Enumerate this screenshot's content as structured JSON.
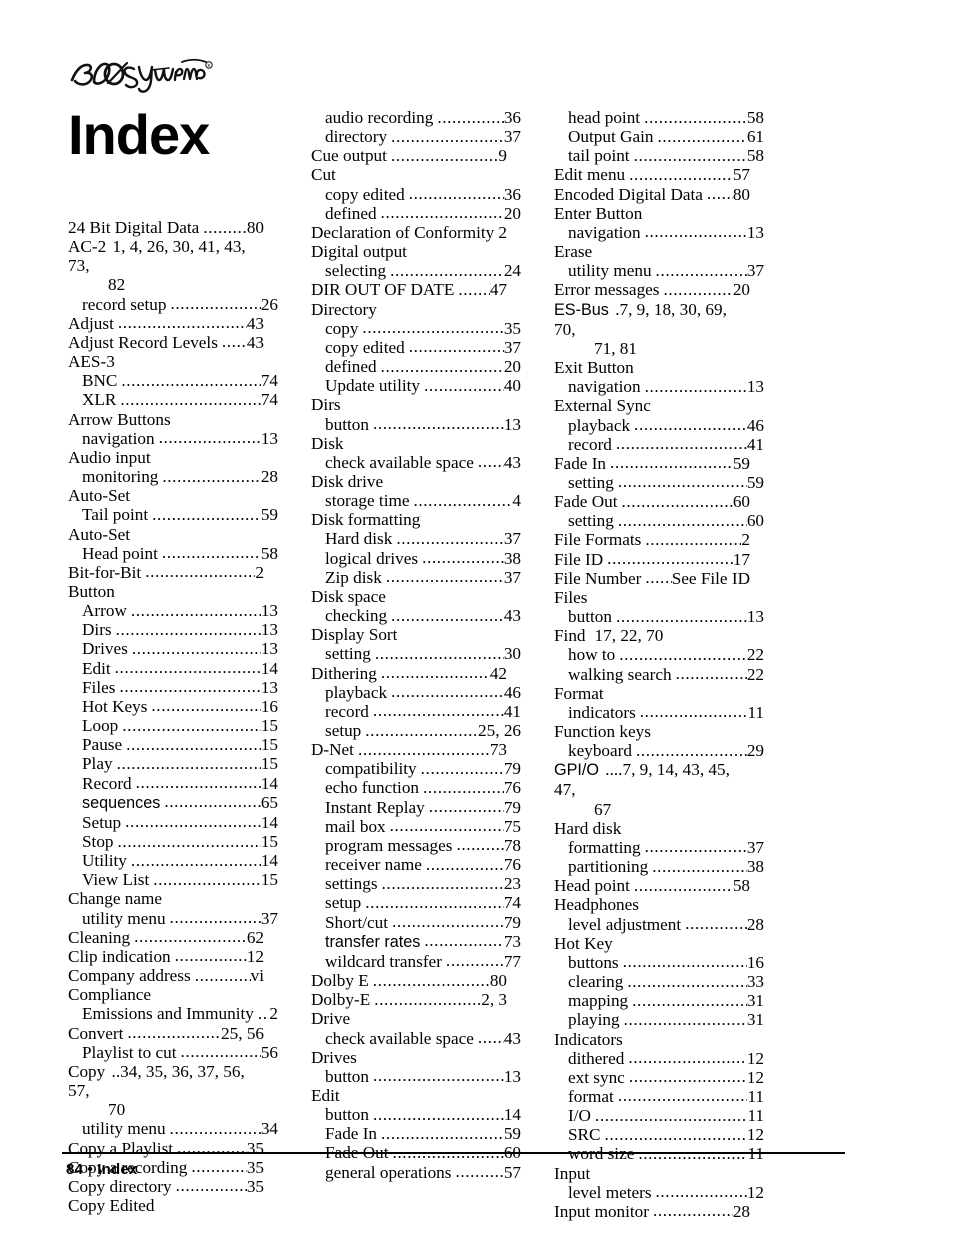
{
  "logo": {
    "alt_text": "360 Systems",
    "trademark": "®"
  },
  "page_title": "Index",
  "footer": {
    "text": "84 • Index"
  },
  "columns": [
    {
      "id": "col-1",
      "entries": [
        {
          "term": "24 Bit Digital Data",
          "page": "80",
          "level": 1
        },
        {
          "term": "AC-2",
          "pages_inline": "1, 4, 26, 30, 41, 43, 73,",
          "continuation": "82",
          "level": 1,
          "wrap": true
        },
        {
          "term": "record setup",
          "page": "26",
          "level": 2
        },
        {
          "term": "Adjust",
          "page": "43",
          "level": 1
        },
        {
          "term": "Adjust Record Levels",
          "page": "43",
          "level": 1
        },
        {
          "term": "AES-3",
          "page": "",
          "level": 1,
          "heading": true
        },
        {
          "term": "BNC",
          "page": "74",
          "level": 2
        },
        {
          "term": "XLR",
          "page": "74",
          "level": 2
        },
        {
          "term": "Arrow Buttons",
          "page": "",
          "level": 1,
          "heading": true
        },
        {
          "term": "navigation",
          "page": "13",
          "level": 2
        },
        {
          "term": "Audio input",
          "page": "",
          "level": 1,
          "heading": true
        },
        {
          "term": "monitoring",
          "page": "28",
          "level": 2
        },
        {
          "term": "Auto-Set",
          "page": "",
          "level": 1,
          "heading": true
        },
        {
          "term": "Tail point",
          "page": "59",
          "level": 2
        },
        {
          "term": "Auto-Set",
          "page": "",
          "level": 1,
          "heading": true
        },
        {
          "term": "Head point",
          "page": "58",
          "level": 2
        },
        {
          "term": "Bit-for-Bit",
          "page": "2",
          "level": 1
        },
        {
          "term": "Button",
          "page": "",
          "level": 1,
          "heading": true
        },
        {
          "term": "Arrow",
          "page": "13",
          "level": 2
        },
        {
          "term": "Dirs",
          "page": "13",
          "level": 2
        },
        {
          "term": "Drives",
          "page": "13",
          "level": 2
        },
        {
          "term": "Edit",
          "page": "14",
          "level": 2
        },
        {
          "term": "Files",
          "page": "13",
          "level": 2
        },
        {
          "term": "Hot Keys",
          "page": "16",
          "level": 2
        },
        {
          "term": "Loop",
          "page": "15",
          "level": 2
        },
        {
          "term": "Pause",
          "page": "15",
          "level": 2
        },
        {
          "term": "Play",
          "page": "15",
          "level": 2
        },
        {
          "term": "Record",
          "page": "14",
          "level": 2
        },
        {
          "term": "sequences",
          "page": "65",
          "level": 2,
          "sans": true
        },
        {
          "term": "Setup",
          "page": "14",
          "level": 2
        },
        {
          "term": "Stop",
          "page": "15",
          "level": 2
        },
        {
          "term": "Utility",
          "page": "14",
          "level": 2
        },
        {
          "term": "View List",
          "page": "15",
          "level": 2
        },
        {
          "term": "Change name",
          "page": "",
          "level": 1,
          "heading": true
        },
        {
          "term": "utility menu",
          "page": "37",
          "level": 2
        },
        {
          "term": "Cleaning",
          "page": "62",
          "level": 1
        },
        {
          "term": "Clip indication",
          "page": "12",
          "level": 1
        },
        {
          "term": "Company address",
          "page": "vi",
          "level": 1
        },
        {
          "term": "Compliance",
          "page": "",
          "level": 1,
          "heading": true
        },
        {
          "term": "Emissions and Immunity",
          "page": "2",
          "level": 2
        },
        {
          "term": "Convert",
          "page": "25, 56",
          "level": 1
        },
        {
          "term": "Playlist to cut",
          "page": "56",
          "level": 2
        },
        {
          "term": "Copy",
          "pages_inline": "34, 35, 36, 37, 56, 57,",
          "continuation": "70",
          "level": 1,
          "wrap": true,
          "dots_before": ".."
        },
        {
          "term": "utility menu",
          "page": "34",
          "level": 2
        },
        {
          "term": "Copy a Playlist",
          "page": "35",
          "level": 1
        },
        {
          "term": "Copy a recording",
          "page": "35",
          "level": 1
        },
        {
          "term": "Copy directory",
          "page": "35",
          "level": 1
        },
        {
          "term": "Copy Edited",
          "page": "",
          "level": 1,
          "heading": true
        }
      ]
    },
    {
      "id": "col-2",
      "entries": [
        {
          "term": "audio recording",
          "page": "36",
          "level": 2
        },
        {
          "term": "directory",
          "page": "37",
          "level": 2
        },
        {
          "term": "Cue output",
          "page": "9",
          "level": 1
        },
        {
          "term": "Cut",
          "page": "",
          "level": 1,
          "heading": true
        },
        {
          "term": "copy edited",
          "page": "36",
          "level": 2
        },
        {
          "term": "defined",
          "page": "20",
          "level": 2
        },
        {
          "term": "Declaration of Conformity",
          "page": "2",
          "level": 1
        },
        {
          "term": "Digital output",
          "page": "",
          "level": 1,
          "heading": true
        },
        {
          "term": "selecting",
          "page": "24",
          "level": 2
        },
        {
          "term": "DIR OUT OF DATE",
          "page": "47",
          "level": 1
        },
        {
          "term": "Directory",
          "page": "",
          "level": 1,
          "heading": true
        },
        {
          "term": "copy",
          "page": "35",
          "level": 2
        },
        {
          "term": "copy edited",
          "page": "37",
          "level": 2
        },
        {
          "term": "defined",
          "page": "20",
          "level": 2
        },
        {
          "term": "Update utility",
          "page": "40",
          "level": 2
        },
        {
          "term": "Dirs",
          "page": "",
          "level": 1,
          "heading": true
        },
        {
          "term": "button",
          "page": "13",
          "level": 2
        },
        {
          "term": "Disk",
          "page": "",
          "level": 1,
          "heading": true
        },
        {
          "term": "check available space",
          "page": "43",
          "level": 2
        },
        {
          "term": "Disk drive",
          "page": "",
          "level": 1,
          "heading": true
        },
        {
          "term": "storage time",
          "page": "4",
          "level": 2
        },
        {
          "term": "Disk formatting",
          "page": "",
          "level": 1,
          "heading": true
        },
        {
          "term": "Hard disk",
          "page": "37",
          "level": 2
        },
        {
          "term": "logical drives",
          "page": "38",
          "level": 2
        },
        {
          "term": "Zip disk",
          "page": "37",
          "level": 2
        },
        {
          "term": "Disk space",
          "page": "",
          "level": 1,
          "heading": true
        },
        {
          "term": "checking",
          "page": "43",
          "level": 2
        },
        {
          "term": "Display Sort",
          "page": "",
          "level": 1,
          "heading": true
        },
        {
          "term": "setting",
          "page": "30",
          "level": 2
        },
        {
          "term": "Dithering",
          "page": "42",
          "level": 1
        },
        {
          "term": "playback",
          "page": "46",
          "level": 2
        },
        {
          "term": "record",
          "page": "41",
          "level": 2
        },
        {
          "term": "setup",
          "page": "25, 26",
          "level": 2
        },
        {
          "term": "D-Net",
          "page": "73",
          "level": 1
        },
        {
          "term": "compatibility",
          "page": "79",
          "level": 2
        },
        {
          "term": "echo function",
          "page": "76",
          "level": 2
        },
        {
          "term": "Instant Replay",
          "page": "79",
          "level": 2
        },
        {
          "term": "mail box",
          "page": "75",
          "level": 2
        },
        {
          "term": "program messages",
          "page": "78",
          "level": 2
        },
        {
          "term": "receiver name",
          "page": "76",
          "level": 2
        },
        {
          "term": "settings",
          "page": "23",
          "level": 2
        },
        {
          "term": "setup",
          "page": "74",
          "level": 2
        },
        {
          "term": "Short/cut",
          "page": "79",
          "level": 2
        },
        {
          "term": "transfer rates",
          "page": "73",
          "level": 2,
          "sans": true
        },
        {
          "term": "wildcard transfer",
          "page": "77",
          "level": 2
        },
        {
          "term": "Dolby E",
          "page": "80",
          "level": 1
        },
        {
          "term": "Dolby-E",
          "page": "2, 3",
          "level": 1
        },
        {
          "term": "Drive",
          "page": "",
          "level": 1,
          "heading": true
        },
        {
          "term": "check available space",
          "page": "43",
          "level": 2
        },
        {
          "term": "Drives",
          "page": "",
          "level": 1,
          "heading": true
        },
        {
          "term": "button",
          "page": "13",
          "level": 2
        },
        {
          "term": "Edit",
          "page": "",
          "level": 1,
          "heading": true
        },
        {
          "term": "button",
          "page": "14",
          "level": 2
        },
        {
          "term": "Fade In",
          "page": "59",
          "level": 2
        },
        {
          "term": "Fade Out",
          "page": "60",
          "level": 2
        },
        {
          "term": "general operations",
          "page": "57",
          "level": 2
        }
      ]
    },
    {
      "id": "col-3",
      "entries": [
        {
          "term": "head point",
          "page": "58",
          "level": 2
        },
        {
          "term": "Output Gain",
          "page": "61",
          "level": 2
        },
        {
          "term": "tail point",
          "page": "58",
          "level": 2
        },
        {
          "term": "Edit menu",
          "page": "57",
          "level": 1
        },
        {
          "term": "Encoded Digital Data",
          "page": "80",
          "level": 1
        },
        {
          "term": "Enter Button",
          "page": "",
          "level": 1,
          "heading": true
        },
        {
          "term": "navigation",
          "page": "13",
          "level": 2
        },
        {
          "term": "Erase",
          "page": "",
          "level": 1,
          "heading": true
        },
        {
          "term": "utility menu",
          "page": "37",
          "level": 2
        },
        {
          "term": "Error messages",
          "page": "20",
          "level": 1
        },
        {
          "term": "ES-Bus",
          "pages_inline": "7, 9, 18, 30, 69, 70,",
          "continuation": "71, 81",
          "level": 1,
          "wrap": true,
          "sans": true,
          "dots_before": "."
        },
        {
          "term": "Exit Button",
          "page": "",
          "level": 1,
          "heading": true
        },
        {
          "term": "navigation",
          "page": "13",
          "level": 2
        },
        {
          "term": "External Sync",
          "page": "",
          "level": 1,
          "heading": true
        },
        {
          "term": "playback",
          "page": "46",
          "level": 2
        },
        {
          "term": "record",
          "page": "41",
          "level": 2
        },
        {
          "term": "Fade In",
          "page": "59",
          "level": 1
        },
        {
          "term": "setting",
          "page": "59",
          "level": 2
        },
        {
          "term": "Fade Out",
          "page": "60",
          "level": 1
        },
        {
          "term": "setting",
          "page": "60",
          "level": 2
        },
        {
          "term": "File Formats",
          "page": "2",
          "level": 1
        },
        {
          "term": "File ID",
          "page": "17",
          "level": 1
        },
        {
          "term": "File Number",
          "page": "See File ID",
          "level": 1
        },
        {
          "term": "Files",
          "page": "",
          "level": 1,
          "heading": true
        },
        {
          "term": "button",
          "page": "13",
          "level": 2
        },
        {
          "term": "Find",
          "page": "17, 22, 70",
          "level": 1,
          "nodots": true
        },
        {
          "term": "how to",
          "page": "22",
          "level": 2
        },
        {
          "term": "walking search",
          "page": "22",
          "level": 2
        },
        {
          "term": "Format",
          "page": "",
          "level": 1,
          "heading": true
        },
        {
          "term": "indicators",
          "page": "11",
          "level": 2
        },
        {
          "term": "Function keys",
          "page": "",
          "level": 1,
          "heading": true
        },
        {
          "term": "keyboard",
          "page": "29",
          "level": 2
        },
        {
          "term": "GPI/O",
          "pages_inline": "7, 9, 14, 43, 45, 47,",
          "continuation": "67",
          "level": 1,
          "wrap": true,
          "sans": true,
          "dots_before": "...."
        },
        {
          "term": "Hard disk",
          "page": "",
          "level": 1,
          "heading": true
        },
        {
          "term": "formatting",
          "page": "37",
          "level": 2
        },
        {
          "term": "partitioning",
          "page": "38",
          "level": 2
        },
        {
          "term": "Head point",
          "page": "58",
          "level": 1
        },
        {
          "term": "Headphones",
          "page": "",
          "level": 1,
          "heading": true
        },
        {
          "term": "level adjustment",
          "page": "28",
          "level": 2
        },
        {
          "term": "Hot Key",
          "page": "",
          "level": 1,
          "heading": true
        },
        {
          "term": "buttons",
          "page": "16",
          "level": 2
        },
        {
          "term": "clearing",
          "page": "33",
          "level": 2
        },
        {
          "term": "mapping",
          "page": "31",
          "level": 2
        },
        {
          "term": "playing",
          "page": "31",
          "level": 2
        },
        {
          "term": "Indicators",
          "page": "",
          "level": 1,
          "heading": true
        },
        {
          "term": "dithered",
          "page": "12",
          "level": 2
        },
        {
          "term": "ext sync",
          "page": "12",
          "level": 2
        },
        {
          "term": "format",
          "page": "11",
          "level": 2
        },
        {
          "term": "I/O",
          "page": "11",
          "level": 2
        },
        {
          "term": "SRC",
          "page": "12",
          "level": 2
        },
        {
          "term": "word size",
          "page": "11",
          "level": 2
        },
        {
          "term": "Input",
          "page": "",
          "level": 1,
          "heading": true
        },
        {
          "term": "level meters",
          "page": "12",
          "level": 2
        },
        {
          "term": "Input monitor",
          "page": "28",
          "level": 1
        }
      ]
    }
  ]
}
